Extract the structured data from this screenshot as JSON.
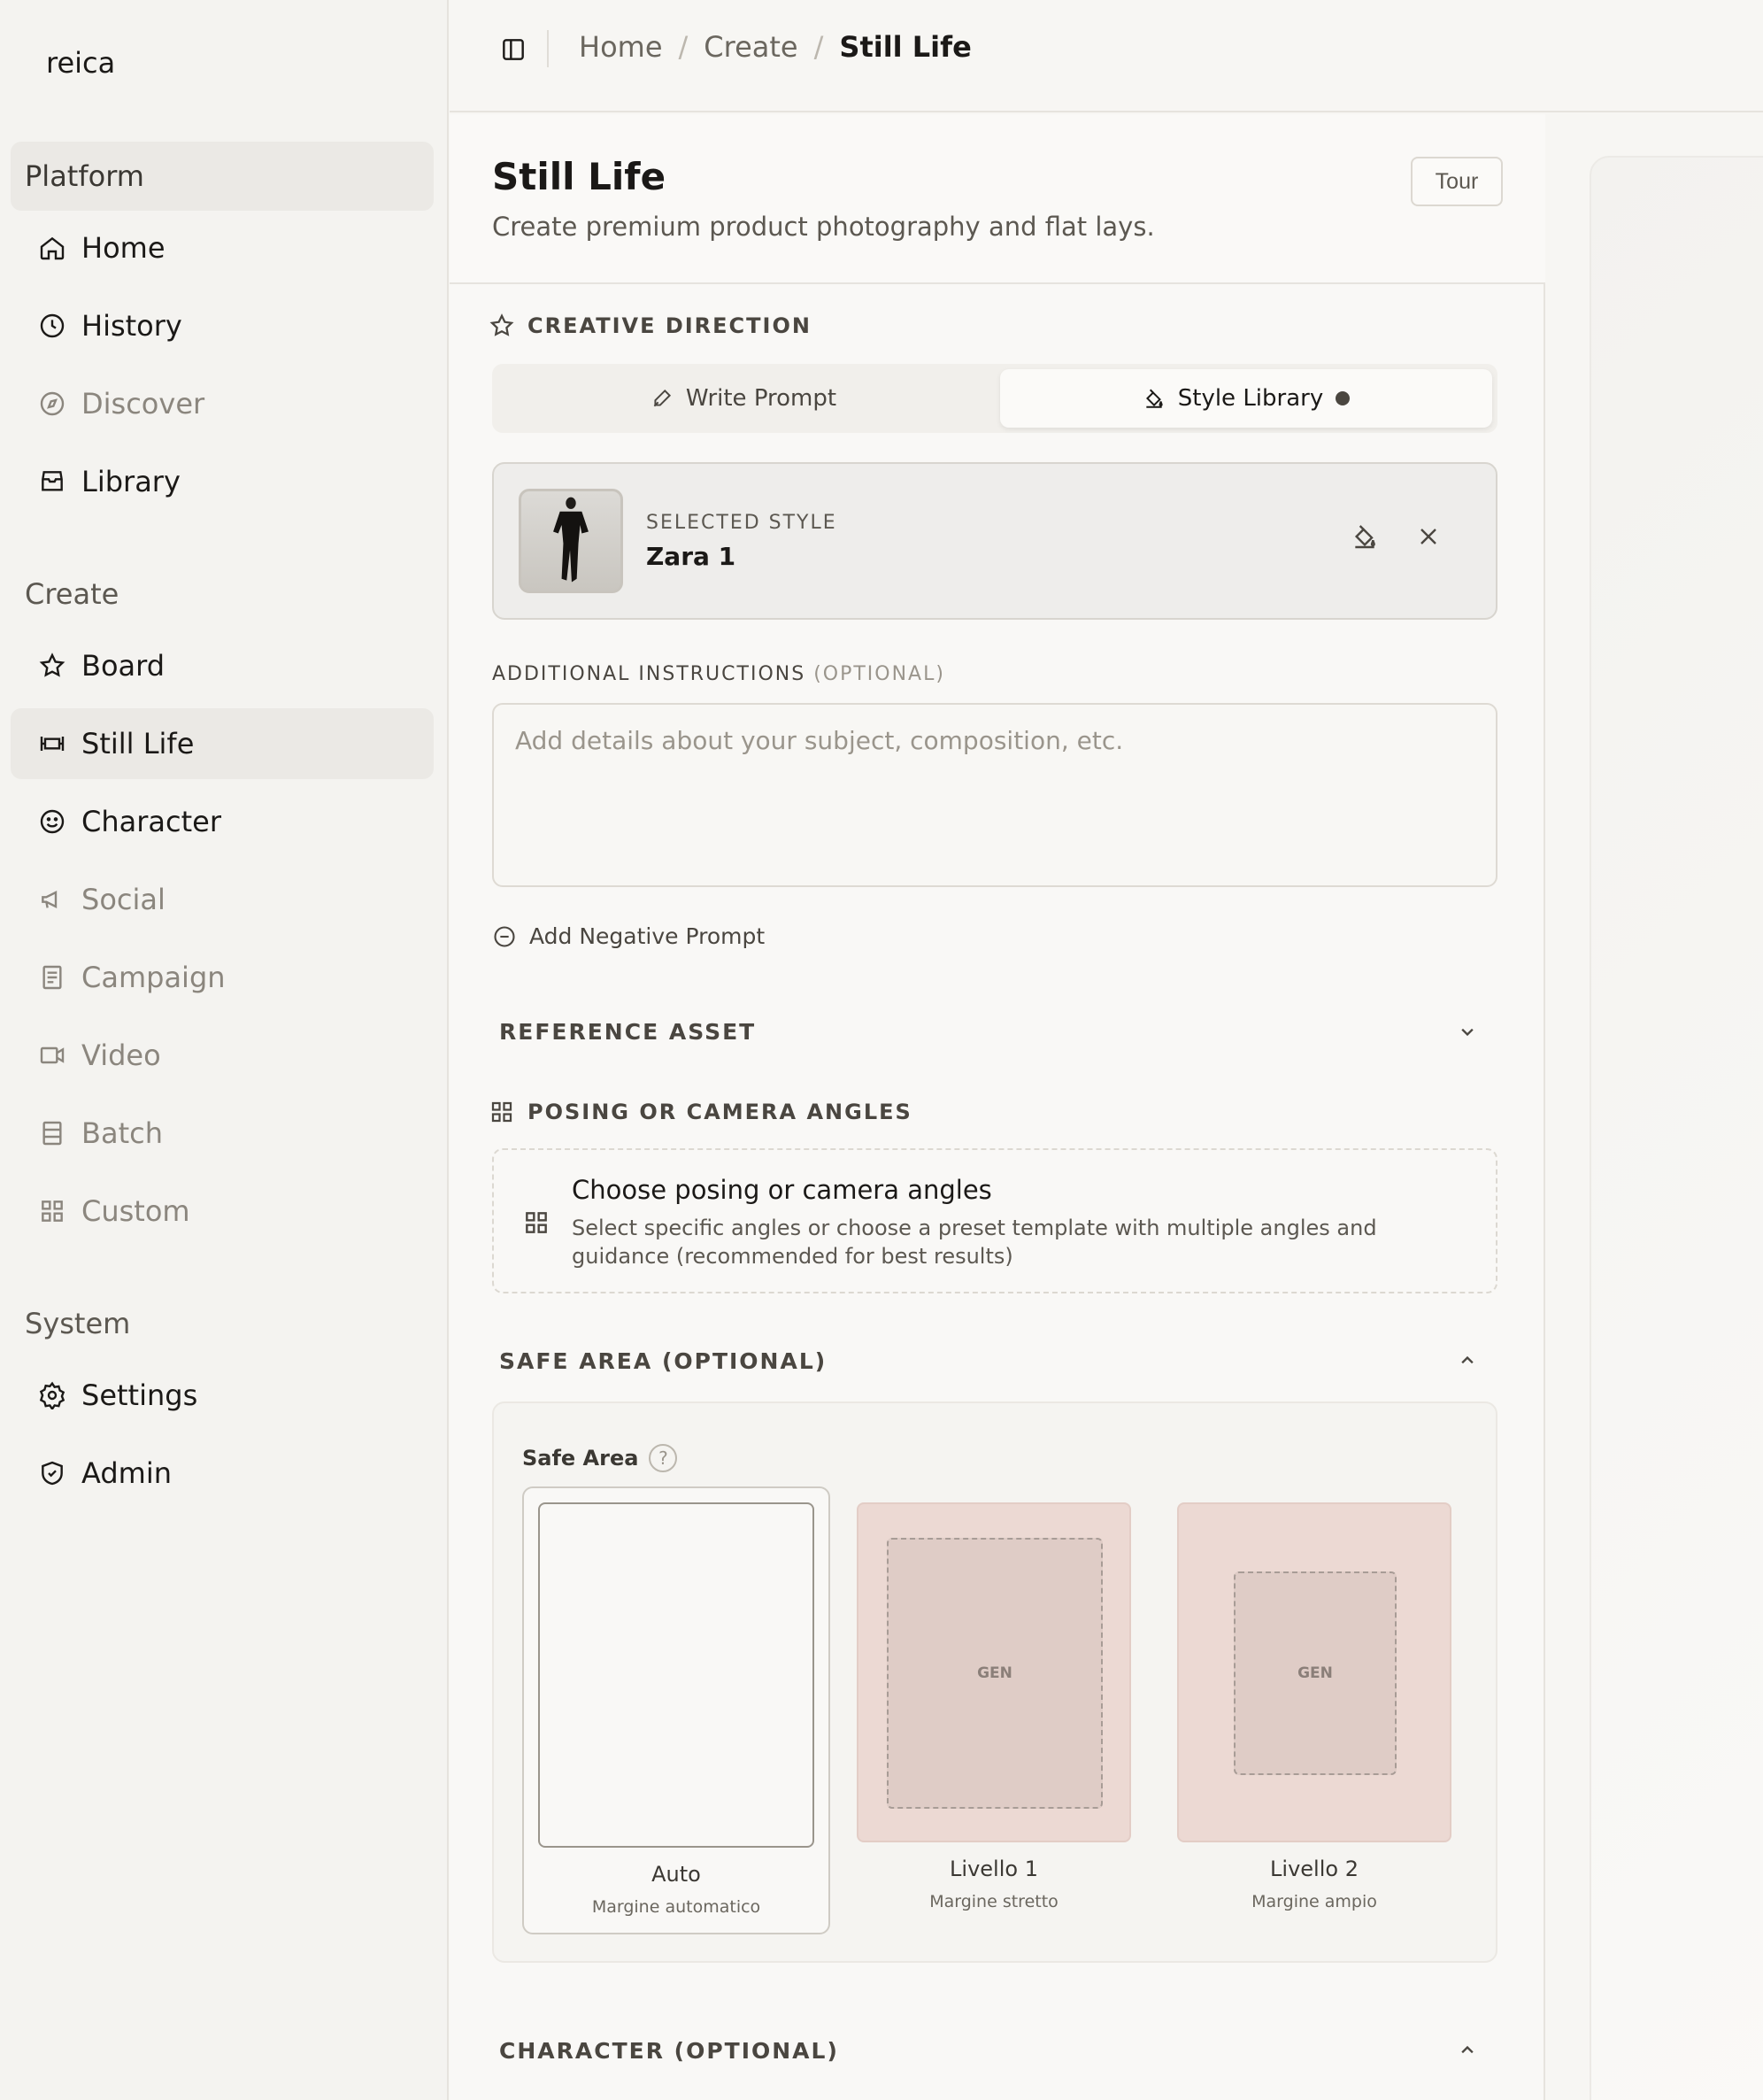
{
  "brand": "reica",
  "sidebar": {
    "platform_label": "Platform",
    "platform_items": [
      {
        "label": "Home"
      },
      {
        "label": "History"
      },
      {
        "label": "Discover"
      },
      {
        "label": "Library"
      }
    ],
    "create_label": "Create",
    "create_items": [
      {
        "label": "Board"
      },
      {
        "label": "Still Life"
      },
      {
        "label": "Character"
      },
      {
        "label": "Social"
      },
      {
        "label": "Campaign"
      },
      {
        "label": "Video"
      },
      {
        "label": "Batch"
      },
      {
        "label": "Custom"
      }
    ],
    "system_label": "System",
    "system_items": [
      {
        "label": "Settings"
      },
      {
        "label": "Admin"
      }
    ]
  },
  "breadcrumb": {
    "items": [
      "Home",
      "Create"
    ],
    "separator": "/",
    "current": "Still Life"
  },
  "header": {
    "title": "Still Life",
    "subtitle": "Create premium product photography and flat lays.",
    "tour_label": "Tour"
  },
  "creative_direction": {
    "heading": "CREATIVE DIRECTION",
    "tabs": [
      {
        "label": "Write Prompt"
      },
      {
        "label": "Style Library"
      }
    ],
    "selected_style_label": "SELECTED STYLE",
    "selected_style_name": "Zara 1"
  },
  "additional_instructions": {
    "label": "ADDITIONAL INSTRUCTIONS",
    "optional": "(OPTIONAL)",
    "placeholder": "Add details about your subject, composition, etc.",
    "value": ""
  },
  "negative_prompt_label": "Add Negative Prompt",
  "reference_asset_label": "REFERENCE ASSET",
  "posing": {
    "heading": "POSING OR CAMERA ANGLES",
    "title": "Choose posing or camera angles",
    "description": "Select specific angles or choose a preset template with multiple angles and guidance (recommended for best results)"
  },
  "safe_area": {
    "section_label": "SAFE AREA (OPTIONAL)",
    "label": "Safe Area",
    "help": "?",
    "options": [
      {
        "name": "Auto",
        "desc": "Margine automatico"
      },
      {
        "name": "Livello 1",
        "desc": "Margine stretto",
        "marker": "GEN"
      },
      {
        "name": "Livello 2",
        "desc": "Margine ampio",
        "marker": "GEN"
      }
    ]
  },
  "character_label": "CHARACTER (OPTIONAL)",
  "colors": {
    "background": "#f7f6f3",
    "sidebar": "#f4f3f0",
    "active_nav": "#ebe9e5",
    "safe_pink": "#ecd9d3",
    "text": "#1b1917"
  }
}
